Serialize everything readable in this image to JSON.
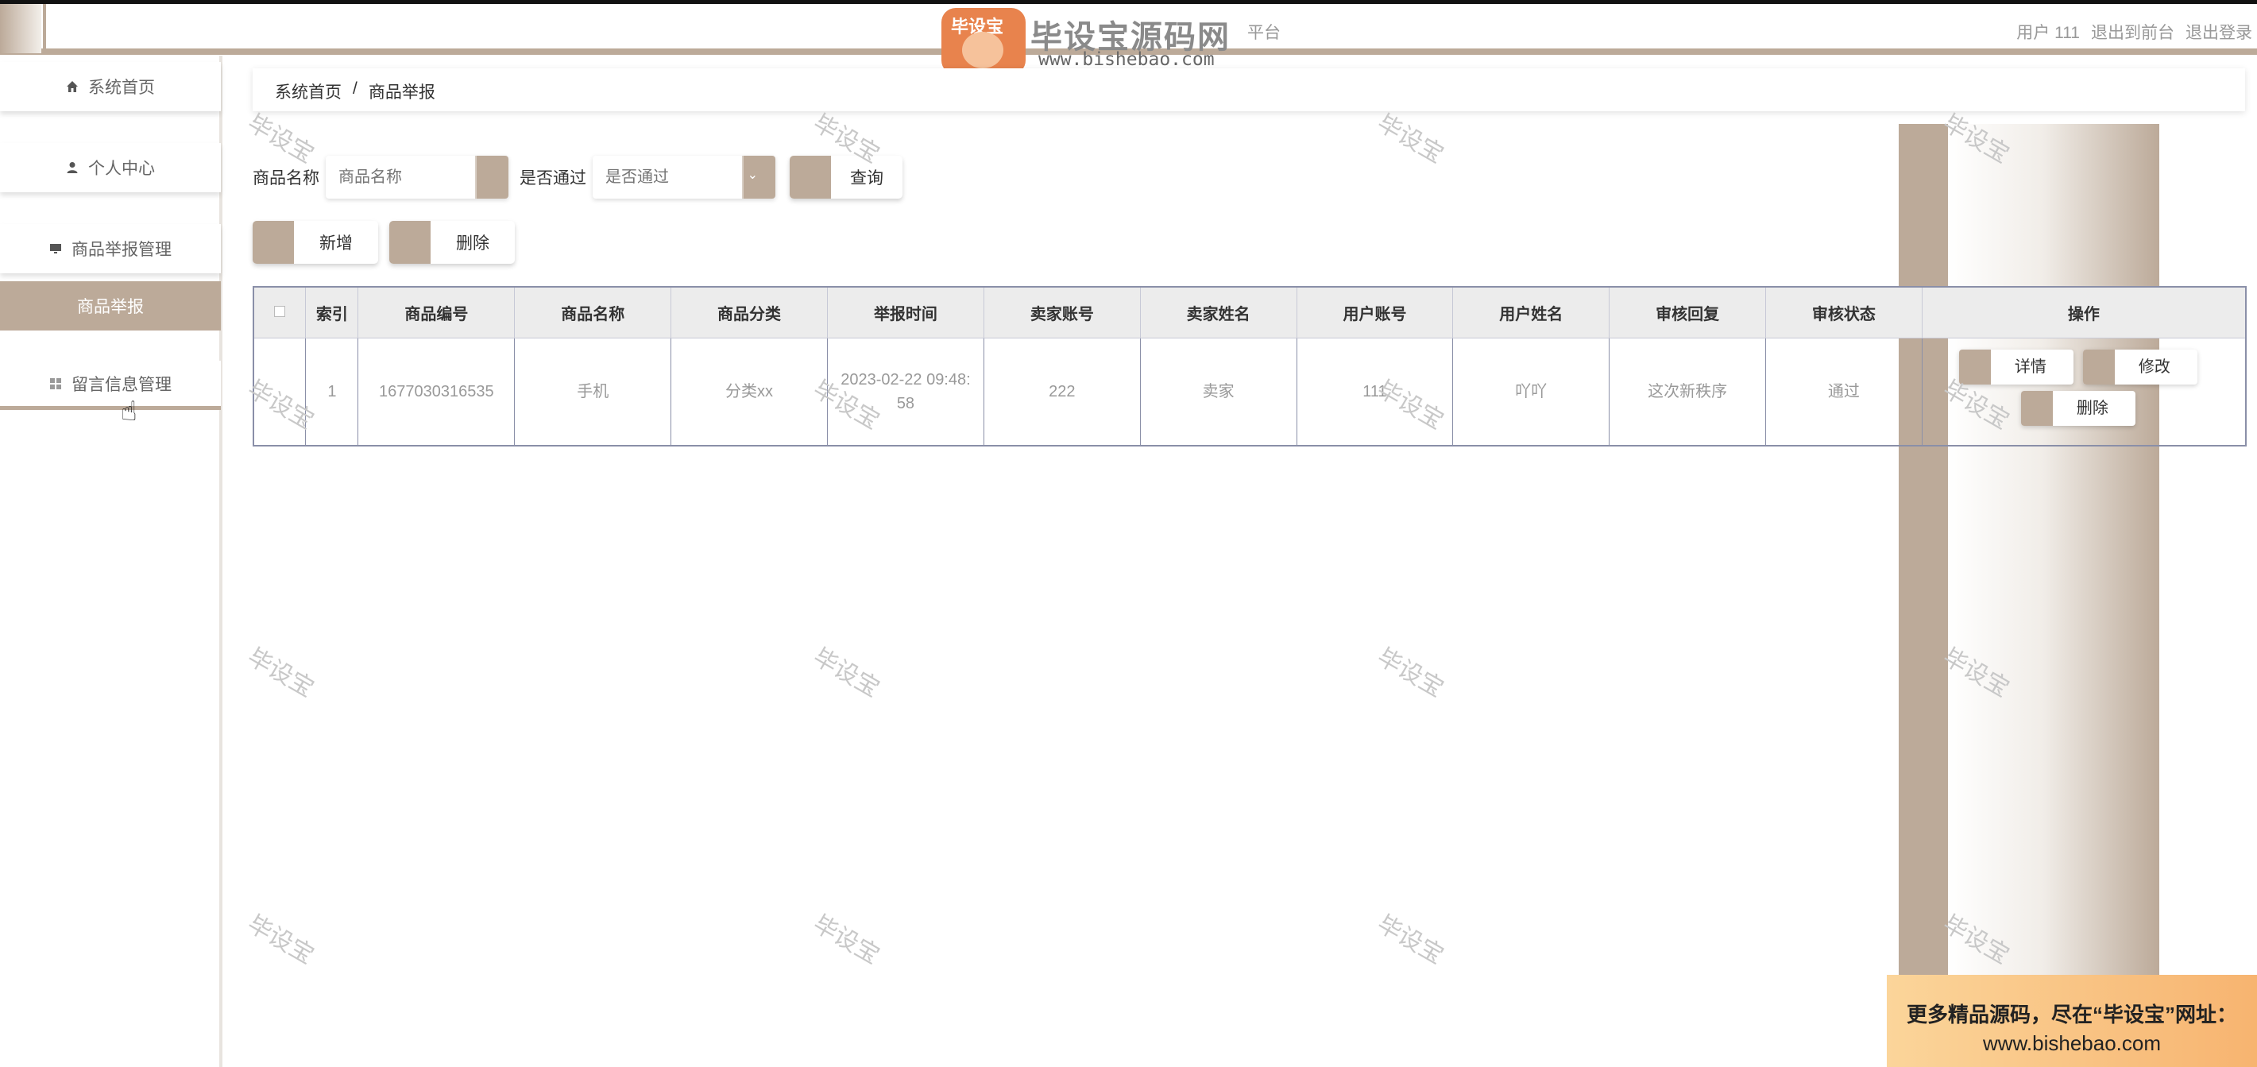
{
  "header": {
    "title": "平台",
    "user": "用户 111",
    "exit_front": "退出到前台",
    "logout": "退出登录"
  },
  "logo": {
    "badge_text": "毕设宝",
    "name": "毕设宝源码网",
    "url": "www.bishebao.com"
  },
  "sidebar": {
    "items": [
      {
        "label": "系统首页",
        "icon": "home-icon"
      },
      {
        "label": "个人中心",
        "icon": "user-icon"
      },
      {
        "label": "商品举报管理",
        "icon": "monitor-icon"
      },
      {
        "label": "商品举报",
        "icon": ""
      },
      {
        "label": "留言信息管理",
        "icon": "grid-icon"
      }
    ]
  },
  "breadcrumb": {
    "home": "系统首页",
    "sep": "/",
    "current": "商品举报"
  },
  "search": {
    "name_label": "商品名称",
    "name_placeholder": "商品名称",
    "pass_label": "是否通过",
    "pass_placeholder": "是否通过",
    "query_label": "查询"
  },
  "actions": {
    "add_label": "新增",
    "delete_label": "删除"
  },
  "table": {
    "headers": [
      "",
      "索引",
      "商品编号",
      "商品名称",
      "商品分类",
      "举报时间",
      "卖家账号",
      "卖家姓名",
      "用户账号",
      "用户姓名",
      "审核回复",
      "审核状态",
      "操作"
    ],
    "rows": [
      {
        "index": "1",
        "product_no": "1677030316535",
        "product_name": "手机",
        "category": "分类xx",
        "report_time": "2023-02-22 09:48:58",
        "seller_account": "222",
        "seller_name": "卖家",
        "user_account": "111",
        "user_name": "吖吖",
        "review_reply": "这次新秩序",
        "review_status": "通过",
        "ops": {
          "detail": "详情",
          "edit": "修改",
          "delete": "删除"
        }
      }
    ]
  },
  "watermark": "毕设宝",
  "promo": {
    "line1": "更多精品源码，尽在“毕设宝”网址：",
    "line2": "www.bishebao.com"
  },
  "colors": {
    "accent": "#bcaa99",
    "promo_start": "#fbd59a",
    "promo_end": "#f7b470"
  }
}
